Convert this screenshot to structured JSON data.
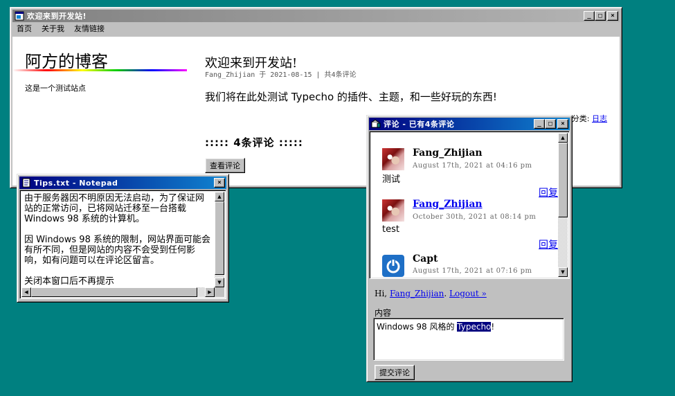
{
  "blog_window": {
    "title": "欢迎来到开发站!",
    "menu": [
      "首页",
      "关于我",
      "友情链接"
    ],
    "blog_name": "阿方的博客",
    "blog_desc": "这是一个测试站点",
    "post": {
      "title": "欢迎来到开发站!",
      "meta": "Fang_Zhijian 于 2021-08-15 | 共4条评论",
      "content": "我们将在此处测试 Typecho 的插件、主题，和一些好玩的东西!",
      "category_label": "分类: ",
      "category": "日志"
    },
    "comments_heading": "::::: 4条评论 :::::",
    "view_comments_label": "查看评论"
  },
  "notepad": {
    "title": "Tips.txt - Notepad",
    "text": "由于服务器因不明原因无法启动，为了保证网站的正常访问，已将网站迁移至一台搭载Windows 98 系统的计算机。\n\n因 Windows 98 系统的限制，网站界面可能会有所不同，但是网站的内容不会受到任何影响，如有问题可以在评论区留言。\n\n关闭本窗口后不再提示"
  },
  "comments_window": {
    "title": "评论 - 已有4条评论",
    "comments": [
      {
        "author": "Fang_Zhijian",
        "date": "August 17th, 2021 at 04:16 pm",
        "text": "测试",
        "reply": "回复",
        "avatar": "anime-avatar"
      },
      {
        "author": "Fang_Zhijian",
        "date": "October 30th, 2021 at 08:14 pm",
        "text": "test",
        "reply": "回复",
        "avatar": "anime-avatar"
      },
      {
        "author": "Capt",
        "date": "August 17th, 2021 at 07:16 pm",
        "text": "",
        "reply": "",
        "avatar": "power-icon"
      }
    ],
    "hi_prefix": "Hi, ",
    "user_link": "Fang_Zhijian",
    "logout_link": "Logout »",
    "content_label": "内容",
    "textarea_before": "Windows 98 风格的 ",
    "textarea_highlight": "Typecho",
    "textarea_after": "!",
    "submit_label": "提交评论"
  },
  "colors": {
    "desktop": "#008080",
    "titlebar_active": "#000080",
    "titlebar_inactive": "#808080",
    "link": "#0000ee"
  }
}
